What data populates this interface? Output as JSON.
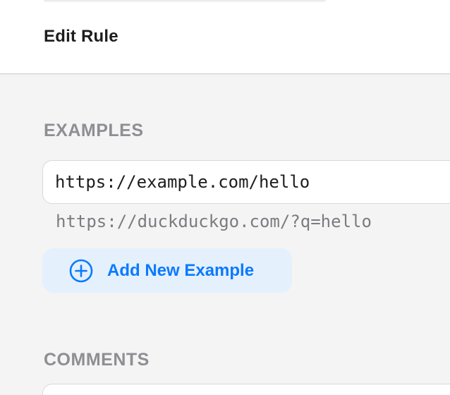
{
  "header": {
    "title": "Edit Rule"
  },
  "examples": {
    "section_title": "EXAMPLES",
    "input_value": "https://example.com/hello",
    "result_text": "https://duckduckgo.com/?q=hello",
    "add_button_label": "Add New Example"
  },
  "comments": {
    "section_title": "COMMENTS"
  },
  "colors": {
    "accent": "#0a7aff",
    "accent_bg": "#e5f0fd",
    "section_title": "#8e8e93",
    "background": "#f4f4f5"
  },
  "icons": {
    "add": "plus-circle-icon"
  }
}
